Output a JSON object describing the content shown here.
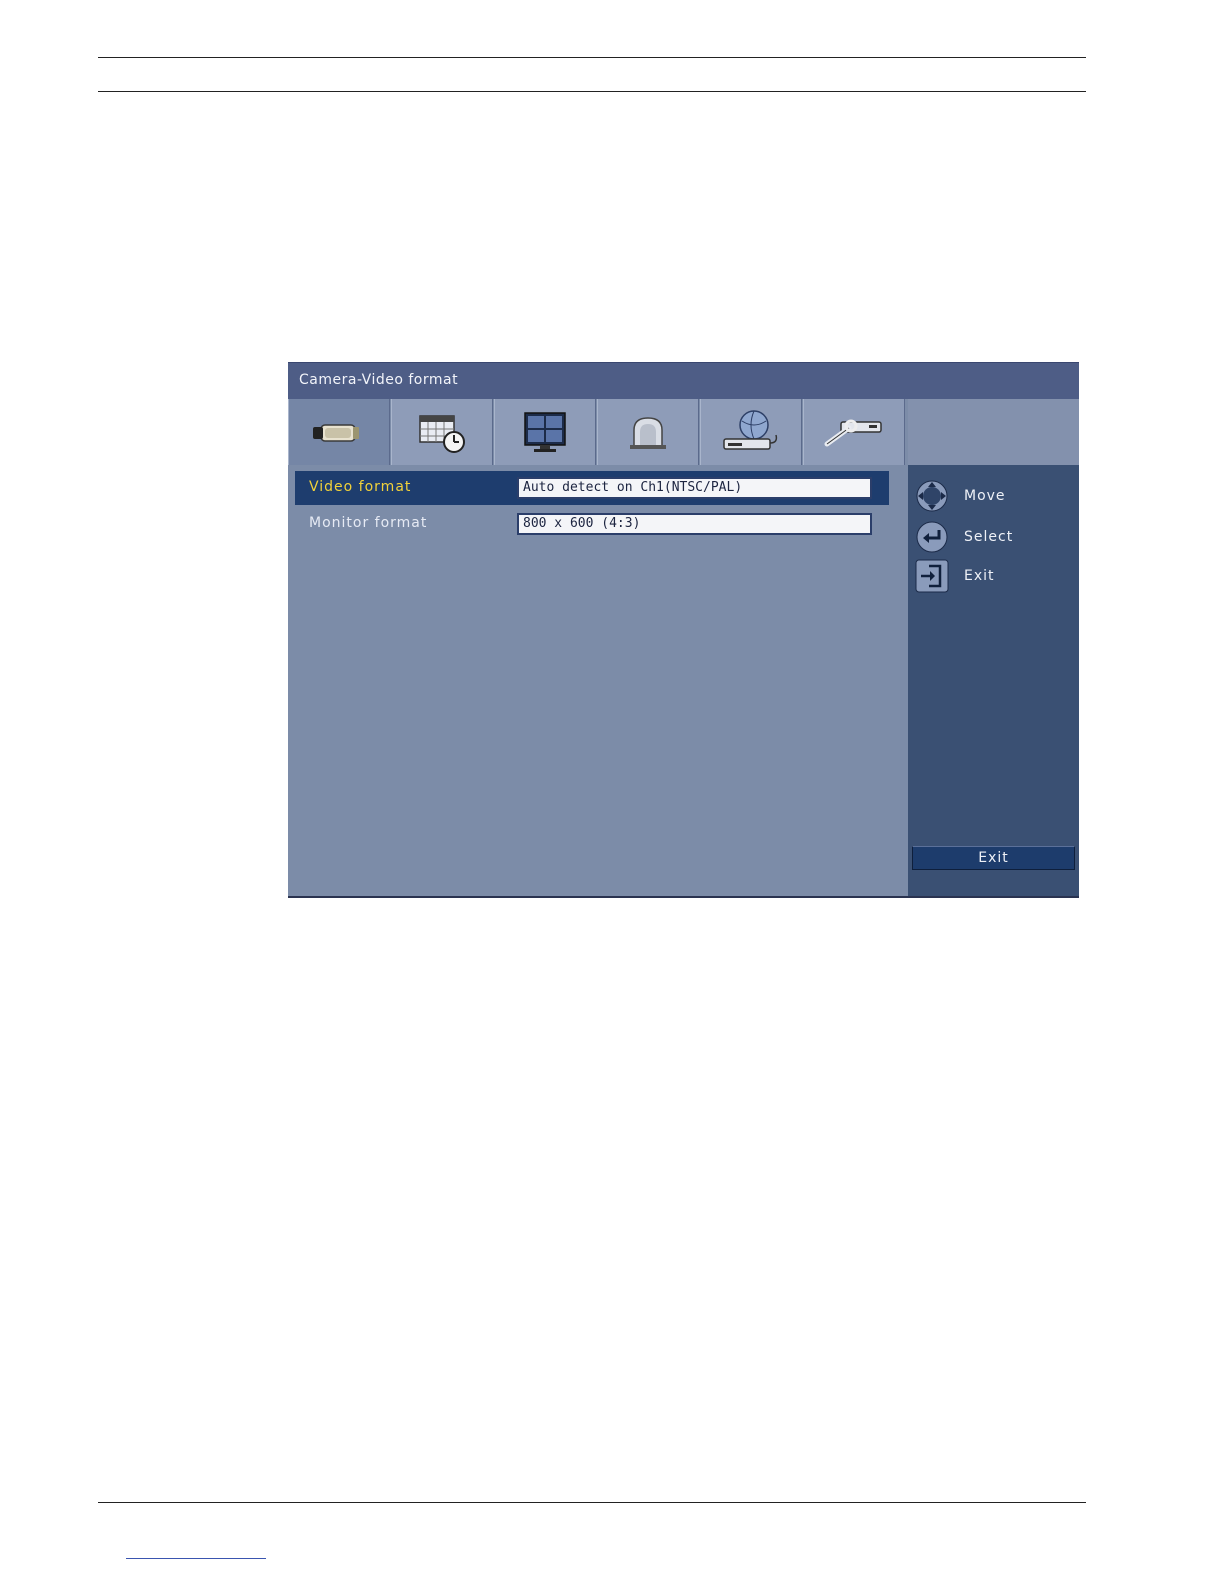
{
  "window": {
    "title": "Camera-Video format"
  },
  "tabs": [
    {
      "name": "camera",
      "icon": "camera-icon",
      "active": true
    },
    {
      "name": "schedule",
      "icon": "calendar-clock-icon",
      "active": false
    },
    {
      "name": "display",
      "icon": "monitor-icon",
      "active": false
    },
    {
      "name": "alarm",
      "icon": "alarm-dome-icon",
      "active": false
    },
    {
      "name": "network",
      "icon": "network-globe-icon",
      "active": false
    },
    {
      "name": "system",
      "icon": "system-tools-icon",
      "active": false
    }
  ],
  "settings": [
    {
      "label": "Video format",
      "value": "Auto detect on Ch1(NTSC/PAL)",
      "selected": true
    },
    {
      "label": "Monitor format",
      "value": "800 x 600 (4:3)",
      "selected": false
    }
  ],
  "hints": [
    {
      "icon": "move-dpad-icon",
      "label": "Move"
    },
    {
      "icon": "enter-icon",
      "label": "Select"
    },
    {
      "icon": "exit-door-icon",
      "label": "Exit"
    }
  ],
  "exit_button": "Exit",
  "colors": {
    "title_bar": "#4e5d86",
    "panel": "#7c8ca8",
    "side_panel": "#3a5073",
    "selected_row": "#1e3d6e",
    "selected_label": "#f2d23a"
  }
}
